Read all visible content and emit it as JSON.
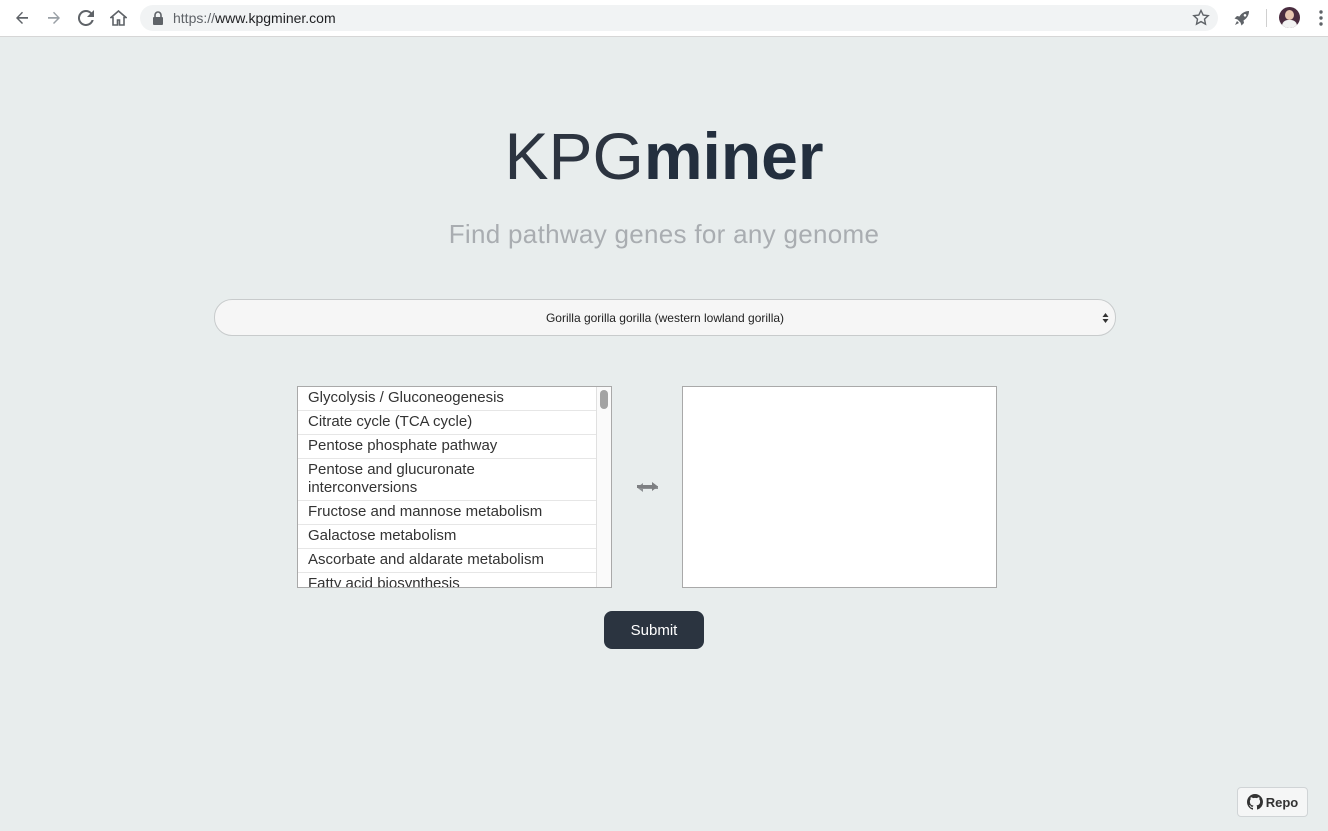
{
  "browser": {
    "url_scheme": "https://",
    "url_host": "www.kpgminer.com"
  },
  "logo": {
    "light": "KPG",
    "bold": "miner"
  },
  "tagline": "Find pathway genes for any genome",
  "genome_select": {
    "selected": "Gorilla gorilla gorilla (western lowland gorilla)"
  },
  "pathways": [
    "Glycolysis / Gluconeogenesis",
    "Citrate cycle (TCA cycle)",
    "Pentose phosphate pathway",
    "Pentose and glucuronate interconversions",
    "Fructose and mannose metabolism",
    "Galactose metabolism",
    "Ascorbate and aldarate metabolism",
    "Fatty acid biosynthesis"
  ],
  "submit_label": "Submit",
  "repo_label": "Repo",
  "colors": {
    "background": "#e8eded",
    "primary": "#2b3440",
    "tagline": "#a9adb1"
  }
}
